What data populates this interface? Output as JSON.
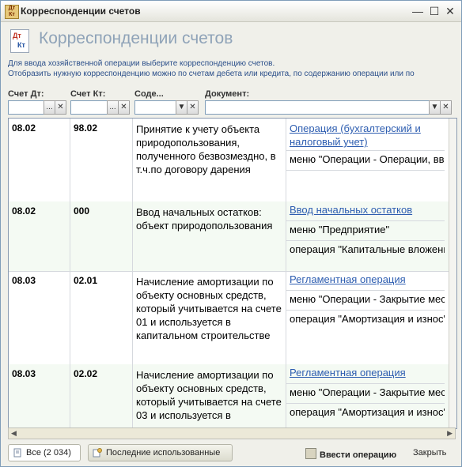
{
  "window": {
    "title": "Корреспонденции счетов"
  },
  "header": {
    "title": "Корреспонденции счетов",
    "icon": "debit-credit-icon"
  },
  "info": {
    "line1": "Для ввода хозяйственной операции выберите корреспонденцию счетов.",
    "line2": "Отобразить нужную корреспонденцию можно по счетам дебета или кредита, по содержанию операции или по"
  },
  "filters": {
    "dt_label": "Счет Дт:",
    "kt_label": "Счет Кт:",
    "content_label": "Соде...",
    "doc_label": "Документ:",
    "dt_value": "",
    "kt_value": "",
    "content_value": "",
    "doc_value": ""
  },
  "rows": [
    {
      "dt": "08.02",
      "kt": "98.02",
      "content": "Принятие к учету объекта природопользования, полученного безвозмездно, в т.ч.по договору дарения",
      "doc": "Операция (бухгалтерский и налоговый учет)",
      "menu": "меню \"Операции - Операции, введенные вручную\"",
      "op": ""
    },
    {
      "dt": "08.02",
      "kt": "000",
      "content": "Ввод начальных остатков: объект природопользования",
      "doc": "Ввод начальных остатков",
      "menu": "меню \"Предприятие\"",
      "op": "операция \"Капитальные вложения\""
    },
    {
      "dt": "08.03",
      "kt": "02.01",
      "content": "Начисление амортизации по объекту основных средств, который учитывается на счете 01 и используется в капитальном строительстве",
      "doc": "Регламентная операция",
      "menu": "меню \"Операции - Закрытие месяца\"",
      "op": "операция \"Амортизация и износ\""
    },
    {
      "dt": "08.03",
      "kt": "02.02",
      "content": "Начисление амортизации по объекту основных средств, который учитывается на счете 03 и используется в",
      "doc": "Регламентная операция",
      "menu": "меню \"Операции - Закрытие месяца\"",
      "op": "операция \"Амортизация и износ\""
    }
  ],
  "tabs": {
    "all": "Все (2 034)",
    "recent": "Последние использованные"
  },
  "actions": {
    "enter": "Ввести операцию",
    "close": "Закрыть"
  }
}
